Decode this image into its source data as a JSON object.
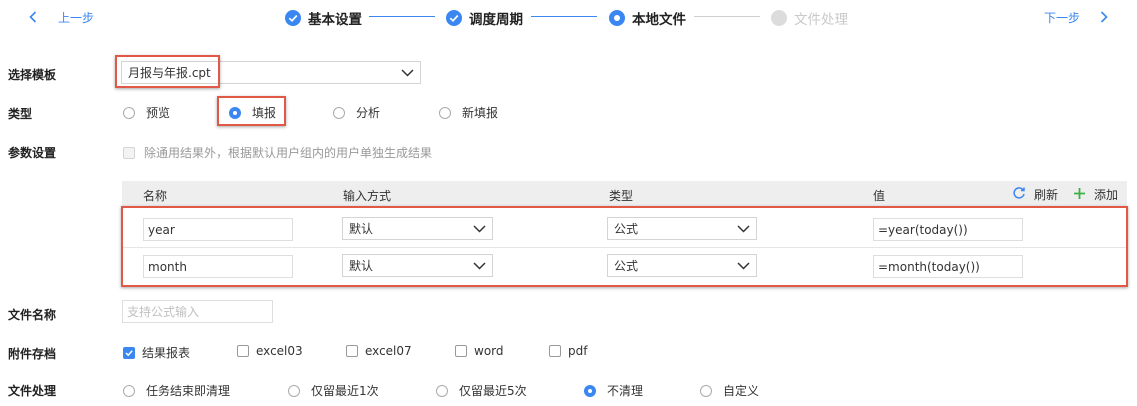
{
  "nav": {
    "prev_label": "上一步",
    "next_label": "下一步"
  },
  "steps": [
    {
      "label": "基本设置",
      "state": "done"
    },
    {
      "label": "调度周期",
      "state": "done"
    },
    {
      "label": "本地文件",
      "state": "current"
    },
    {
      "label": "文件处理",
      "state": "pending"
    }
  ],
  "template": {
    "label": "选择模板",
    "value": "月报与年报.cpt"
  },
  "type": {
    "label": "类型",
    "options": [
      "预览",
      "填报",
      "分析",
      "新填报"
    ],
    "selected": "填报"
  },
  "params": {
    "label": "参数设置",
    "checkbox_label": "除通用结果外，根据默认用户组内的用户单独生成结果",
    "columns": [
      "名称",
      "输入方式",
      "类型",
      "值"
    ],
    "refresh_label": "刷新",
    "add_label": "添加",
    "rows": [
      {
        "name": "year",
        "input_mode": "默认",
        "type": "公式",
        "value": "=year(today())"
      },
      {
        "name": "month",
        "input_mode": "默认",
        "type": "公式",
        "value": "=month(today())"
      }
    ]
  },
  "filename": {
    "label": "文件名称",
    "placeholder": "支持公式输入"
  },
  "attachment": {
    "label": "附件存档",
    "options": [
      {
        "label": "结果报表",
        "checked": true
      },
      {
        "label": "excel03",
        "checked": false
      },
      {
        "label": "excel07",
        "checked": false
      },
      {
        "label": "word",
        "checked": false
      },
      {
        "label": "pdf",
        "checked": false
      }
    ]
  },
  "file_processing": {
    "label": "文件处理",
    "options": [
      "任务结束即清理",
      "仅留最近1次",
      "仅留最近5次",
      "不清理",
      "自定义"
    ],
    "selected": "不清理"
  },
  "colors": {
    "accent": "#3a87f2",
    "highlight": "#e15846",
    "add_green": "#3fae49"
  }
}
